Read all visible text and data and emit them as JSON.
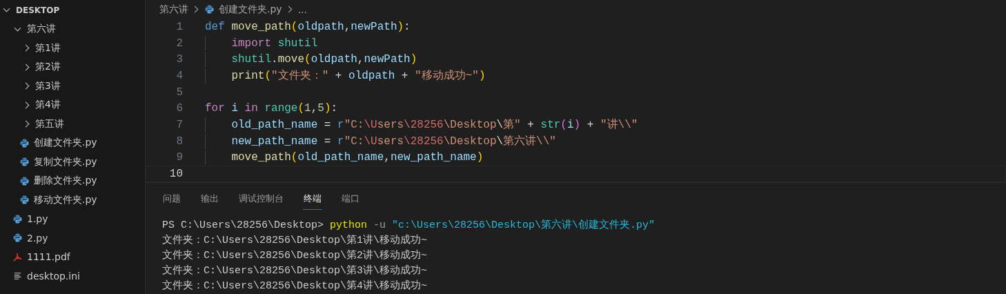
{
  "explorer": {
    "title": "DESKTOP",
    "expanded": true,
    "items": [
      {
        "name": "第六讲",
        "kind": "folder",
        "expanded": true,
        "children": [
          {
            "name": "第1讲",
            "kind": "folder",
            "expanded": false
          },
          {
            "name": "第2讲",
            "kind": "folder",
            "expanded": false
          },
          {
            "name": "第3讲",
            "kind": "folder",
            "expanded": false
          },
          {
            "name": "第4讲",
            "kind": "folder",
            "expanded": false
          },
          {
            "name": "第五讲",
            "kind": "folder",
            "expanded": false
          },
          {
            "name": "创建文件夹.py",
            "kind": "python"
          },
          {
            "name": "复制文件夹.py",
            "kind": "python"
          },
          {
            "name": "删除文件夹.py",
            "kind": "python"
          },
          {
            "name": "移动文件夹.py",
            "kind": "python"
          }
        ]
      },
      {
        "name": "1.py",
        "kind": "python"
      },
      {
        "name": "2.py",
        "kind": "python"
      },
      {
        "name": "1111.pdf",
        "kind": "pdf"
      },
      {
        "name": "desktop.ini",
        "kind": "text"
      }
    ]
  },
  "breadcrumb": {
    "folder": "第六讲",
    "file": "创建文件夹.py",
    "more": "..."
  },
  "editor": {
    "lines": [
      {
        "number": "1",
        "selected": false,
        "tokens": [
          {
            "kind": "kw",
            "text": "def "
          },
          {
            "kind": "fn",
            "text": "move_path"
          },
          {
            "kind": "br",
            "text": "("
          },
          {
            "kind": "var",
            "text": "oldpath"
          },
          {
            "kind": "punc",
            "text": ","
          },
          {
            "kind": "var",
            "text": "newPath"
          },
          {
            "kind": "br",
            "text": ")"
          },
          {
            "kind": "punc",
            "text": ":"
          }
        ]
      },
      {
        "number": "2",
        "selected": false,
        "tokens": [
          {
            "kind": "ctl",
            "text": "    import "
          },
          {
            "kind": "mod",
            "text": "shutil"
          }
        ]
      },
      {
        "number": "3",
        "selected": false,
        "tokens": [
          {
            "kind": "mod",
            "text": "    shutil"
          },
          {
            "kind": "punc",
            "text": "."
          },
          {
            "kind": "fn",
            "text": "move"
          },
          {
            "kind": "br",
            "text": "("
          },
          {
            "kind": "var",
            "text": "oldpath"
          },
          {
            "kind": "punc",
            "text": ","
          },
          {
            "kind": "var",
            "text": "newPath"
          },
          {
            "kind": "br",
            "text": ")"
          }
        ]
      },
      {
        "number": "4",
        "selected": false,
        "tokens": [
          {
            "kind": "fn",
            "text": "    print"
          },
          {
            "kind": "br",
            "text": "("
          },
          {
            "kind": "str",
            "text": "\"文件夹：\""
          },
          {
            "kind": "punc",
            "text": " + "
          },
          {
            "kind": "var",
            "text": "oldpath"
          },
          {
            "kind": "punc",
            "text": " + "
          },
          {
            "kind": "str",
            "text": "\"移动成功~\""
          },
          {
            "kind": "br",
            "text": ")"
          }
        ]
      },
      {
        "number": "5",
        "selected": false
      },
      {
        "number": "6",
        "selected": false,
        "tokens": [
          {
            "kind": "ctl",
            "text": "for "
          },
          {
            "kind": "var",
            "text": "i "
          },
          {
            "kind": "ctl",
            "text": "in "
          },
          {
            "kind": "mod",
            "text": "range"
          },
          {
            "kind": "br",
            "text": "("
          },
          {
            "kind": "num",
            "text": "1"
          },
          {
            "kind": "punc",
            "text": ","
          },
          {
            "kind": "num",
            "text": "5"
          },
          {
            "kind": "br",
            "text": ")"
          },
          {
            "kind": "punc",
            "text": ":"
          }
        ]
      },
      {
        "number": "7",
        "selected": false,
        "tokens": [
          {
            "kind": "var",
            "text": "    old_path_name"
          },
          {
            "kind": "punc",
            "text": " = "
          },
          {
            "kind": "kw",
            "text": "r"
          },
          {
            "kind": "str",
            "text": "\"C:"
          },
          {
            "kind": "esc",
            "text": "\\U"
          },
          {
            "kind": "str",
            "text": "sers"
          },
          {
            "kind": "esc",
            "text": "\\28256"
          },
          {
            "kind": "str",
            "text": "\\Desktop"
          },
          {
            "kind": "punc",
            "text": "\\"
          },
          {
            "kind": "str",
            "text": "第\""
          },
          {
            "kind": "punc",
            "text": " + "
          },
          {
            "kind": "mod",
            "text": "str"
          },
          {
            "kind": "br2",
            "text": "("
          },
          {
            "kind": "var",
            "text": "i"
          },
          {
            "kind": "br2",
            "text": ")"
          },
          {
            "kind": "punc",
            "text": " + "
          },
          {
            "kind": "str",
            "text": "\"讲\\\\\""
          }
        ]
      },
      {
        "number": "8",
        "selected": false,
        "tokens": [
          {
            "kind": "var",
            "text": "    new_path_name"
          },
          {
            "kind": "punc",
            "text": " = "
          },
          {
            "kind": "kw",
            "text": "r"
          },
          {
            "kind": "str",
            "text": "\"C:"
          },
          {
            "kind": "esc",
            "text": "\\U"
          },
          {
            "kind": "str",
            "text": "sers"
          },
          {
            "kind": "esc",
            "text": "\\28256"
          },
          {
            "kind": "str",
            "text": "\\Desktop"
          },
          {
            "kind": "punc",
            "text": "\\"
          },
          {
            "kind": "str",
            "text": "第六讲\\\\\""
          }
        ]
      },
      {
        "number": "9",
        "selected": false,
        "tokens": [
          {
            "kind": "fn",
            "text": "    move_path"
          },
          {
            "kind": "br",
            "text": "("
          },
          {
            "kind": "var",
            "text": "old_path_name"
          },
          {
            "kind": "punc",
            "text": ","
          },
          {
            "kind": "var",
            "text": "new_path_name"
          },
          {
            "kind": "br",
            "text": ")"
          }
        ]
      },
      {
        "number": "10",
        "selected": true
      }
    ]
  },
  "panel": {
    "tabs": [
      {
        "label": "问题",
        "selected": false
      },
      {
        "label": "输出",
        "selected": false
      },
      {
        "label": "调试控制台",
        "selected": false
      },
      {
        "label": "终端",
        "selected": true
      },
      {
        "label": "端口",
        "selected": false
      }
    ],
    "terminal": [
      {
        "tokens": [
          {
            "kind": "plain",
            "text": "PS C:\\Users\\28256\\Desktop> "
          },
          {
            "kind": "cmd",
            "text": "python"
          },
          {
            "kind": "flag",
            "text": " -u "
          },
          {
            "kind": "arg",
            "text": "\"c:\\Users\\28256\\Desktop\\第六讲\\创建文件夹.py\""
          }
        ]
      },
      {
        "tokens": [
          {
            "kind": "plain",
            "text": "文件夹：C:\\Users\\28256\\Desktop\\第1讲\\移动成功~"
          }
        ]
      },
      {
        "tokens": [
          {
            "kind": "plain",
            "text": "文件夹：C:\\Users\\28256\\Desktop\\第2讲\\移动成功~"
          }
        ]
      },
      {
        "tokens": [
          {
            "kind": "plain",
            "text": "文件夹：C:\\Users\\28256\\Desktop\\第3讲\\移动成功~"
          }
        ]
      },
      {
        "tokens": [
          {
            "kind": "plain",
            "text": "文件夹：C:\\Users\\28256\\Desktop\\第4讲\\移动成功~"
          }
        ]
      }
    ]
  }
}
